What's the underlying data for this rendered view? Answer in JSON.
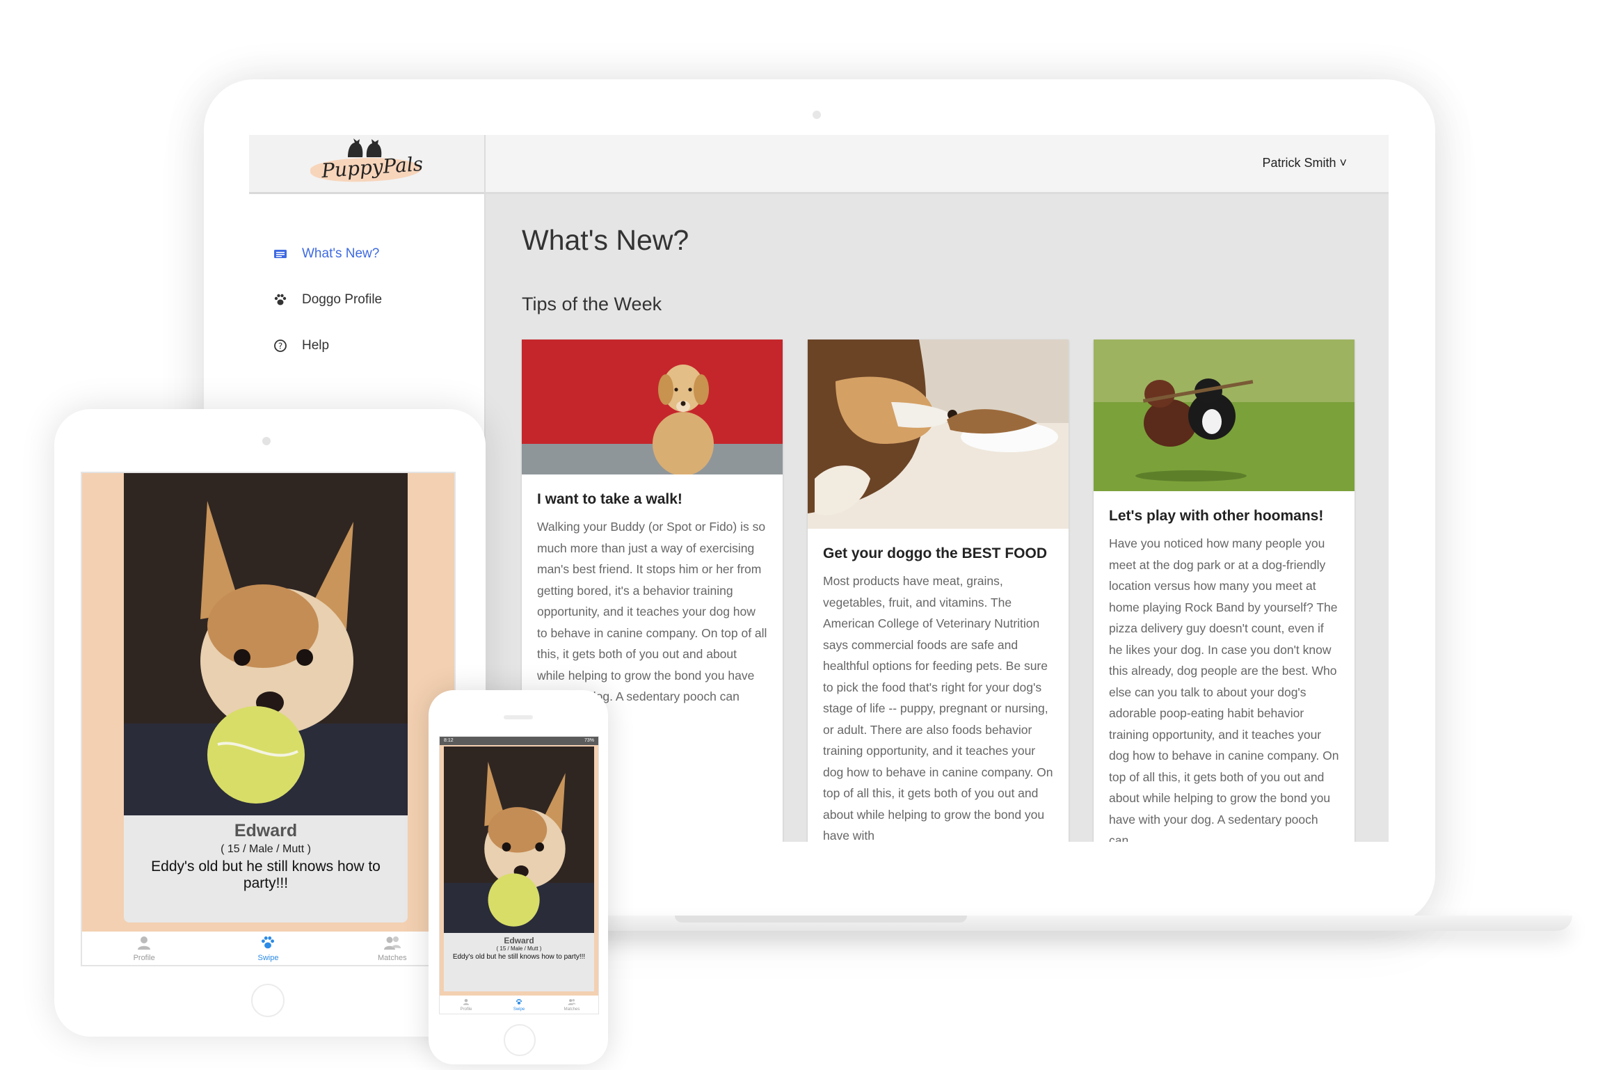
{
  "brand": {
    "name": "PuppyPals"
  },
  "user": {
    "name": "Patrick Smith",
    "chevron": "˅"
  },
  "sidebar": {
    "items": [
      {
        "label": "What's New?",
        "icon": "newspaper-icon",
        "active": true
      },
      {
        "label": "Doggo Profile",
        "icon": "paw-icon",
        "active": false
      },
      {
        "label": "Help",
        "icon": "question-circle-icon",
        "active": false
      }
    ]
  },
  "main": {
    "title": "What's New?",
    "section": "Tips of the Week",
    "cards": [
      {
        "title": "I want to take a walk!",
        "body": "Walking your Buddy (or Spot or Fido) is so much more than just a way of exercising man's best friend. It stops him or her from getting bored, it's a behavior training opportunity, and it teaches your dog how to behave in canine company. On top of all this, it gets both of you out and about while helping to grow the bond you have with your dog. A sedentary pooch can"
      },
      {
        "title": "Get your doggo the BEST FOOD",
        "body": "Most products have meat, grains, vegetables, fruit, and vitamins. The American College of Veterinary Nutrition says commercial foods are safe and healthful options for feeding pets. Be sure to pick the food that's right for your dog's stage of life -- puppy, pregnant or nursing, or adult. There are also foods behavior training opportunity, and it teaches your dog how to behave in canine company. On top of all this, it gets both of you out and about while helping to grow the bond you have with"
      },
      {
        "title": "Let's play with other hoomans!",
        "body": "Have you noticed how many people you meet at the dog park or at a dog-friendly location versus how many you meet at home playing Rock Band by yourself? The pizza delivery guy doesn't count, even if he likes your dog. In case you don't know this already, dog people are the best. Who else can you talk to about your dog's adorable poop-eating habit behavior training opportunity, and it teaches your dog how to behave in canine company. On top of all this, it gets both of you out and about while helping to grow the bond you have with your dog. A sedentary pooch can"
      }
    ]
  },
  "profile_card": {
    "name": "Edward",
    "meta": "( 15 / Male / Mutt )",
    "description": "Eddy's old but he still knows how to party!!!"
  },
  "mobile_tabs": [
    {
      "label": "Profile",
      "icon": "person-icon",
      "active": false
    },
    {
      "label": "Swipe",
      "icon": "paw-icon",
      "active": true
    },
    {
      "label": "Matches",
      "icon": "people-icon",
      "active": false
    }
  ],
  "phone_status": {
    "time": "8:12",
    "battery": "73%"
  },
  "colors": {
    "accent": "#3e6ae1",
    "peach": "#f3d0b1",
    "tab_active": "#2b8be6"
  }
}
